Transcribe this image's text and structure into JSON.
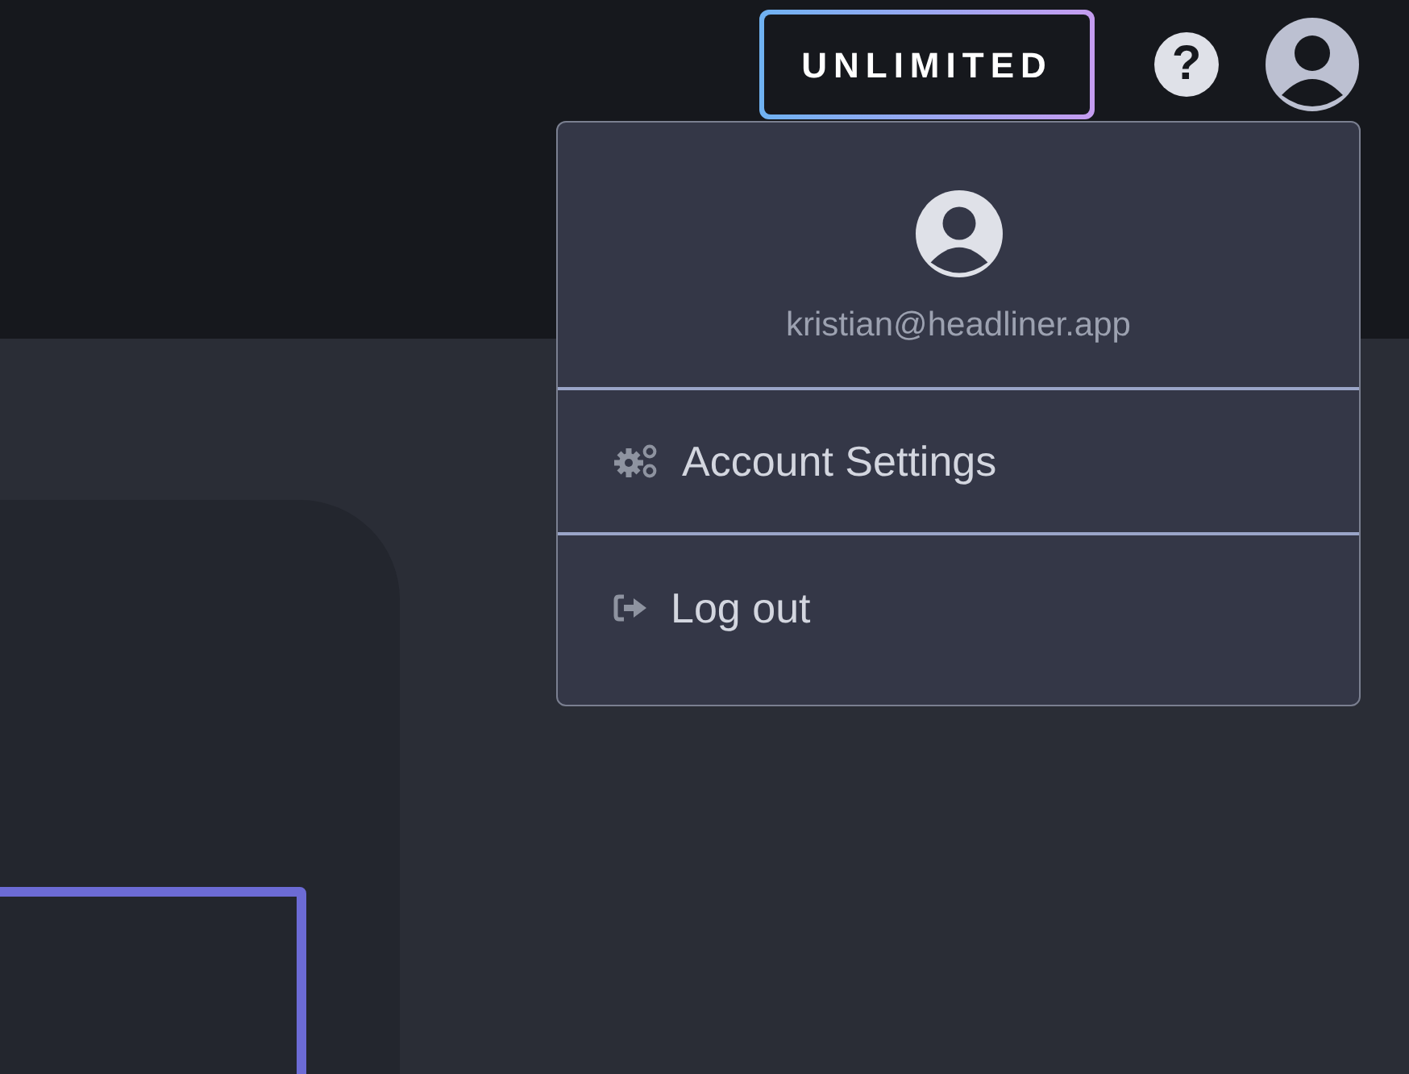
{
  "header": {
    "plan_badge": "UNLIMITED",
    "help": "?"
  },
  "account_menu": {
    "open": true,
    "email": "kristian@headliner.app",
    "items": [
      {
        "kind": "settings",
        "label": "Account Settings"
      },
      {
        "kind": "logout",
        "label": "Log out"
      }
    ]
  }
}
